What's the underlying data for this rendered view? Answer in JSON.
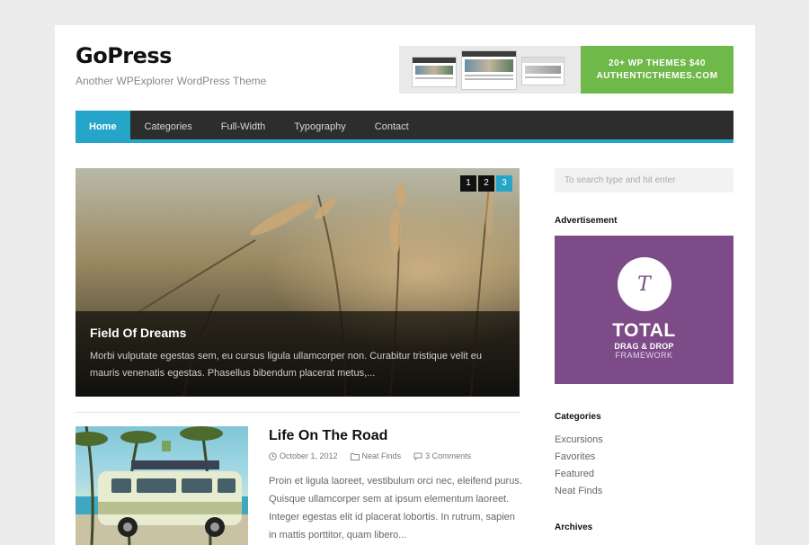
{
  "header": {
    "site_title": "GoPress",
    "tagline": "Another WPExplorer WordPress Theme"
  },
  "banner": {
    "line1": "20+ WP THEMES $40",
    "line2": "AUTHENTICTHEMES.COM",
    "color": "#6fb84a"
  },
  "nav": {
    "items": [
      {
        "label": "Home"
      },
      {
        "label": "Categories"
      },
      {
        "label": "Full-Width"
      },
      {
        "label": "Typography"
      },
      {
        "label": "Contact"
      }
    ],
    "active_color": "#25a6c9"
  },
  "slider": {
    "pages": [
      "1",
      "2",
      "3"
    ],
    "active_page": "3",
    "title": "Field Of Dreams",
    "excerpt": "Morbi vulputate egestas sem, eu cursus ligula ullamcorper non. Curabitur tristique velit eu mauris venenatis egestas. Phasellus bibendum placerat metus,..."
  },
  "post": {
    "title": "Life On The Road",
    "date": "October 1, 2012",
    "category": "Neat Finds",
    "comments": "3 Comments",
    "excerpt": "Proin et ligula laoreet, vestibulum orci nec, eleifend purus. Quisque ullamcorper sem at ipsum elementum laoreet. Integer egestas elit id placerat lobortis. In rutrum, sapien in mattis porttitor, quam libero..."
  },
  "sidebar": {
    "search_placeholder": "To search type and hit enter",
    "ad_title": "Advertisement",
    "ad": {
      "logo_letter": "T",
      "headline": "TOTAL",
      "sub1": "DRAG & DROP",
      "sub2": "FRAMEWORK",
      "color": "#7d4b87"
    },
    "categories_title": "Categories",
    "categories": [
      "Excursions",
      "Favorites",
      "Featured",
      "Neat Finds"
    ],
    "archives_title": "Archives"
  }
}
